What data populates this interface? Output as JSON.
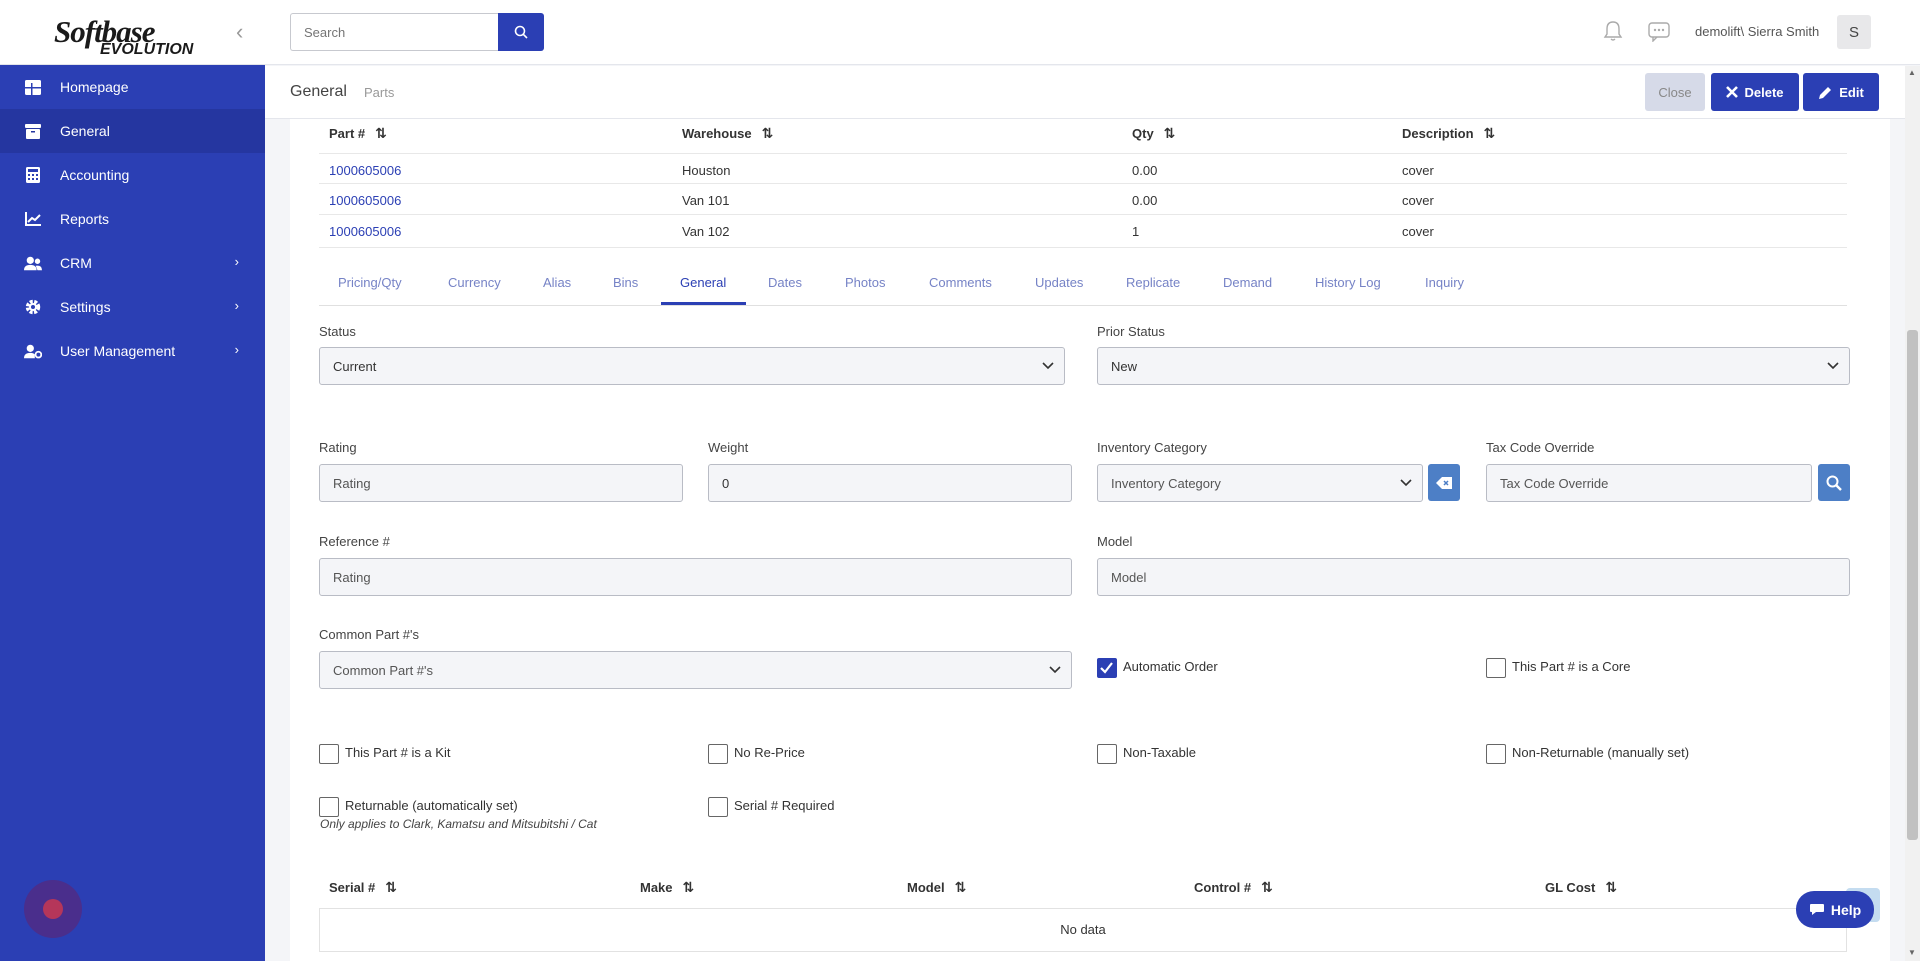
{
  "logo": {
    "line1": "Softbase",
    "line2": "EVOLUTION"
  },
  "sidebar": {
    "items": [
      {
        "label": "Homepage",
        "icon": "home-grid-icon",
        "active": false,
        "has_children": false
      },
      {
        "label": "General",
        "icon": "archive-box-icon",
        "active": true,
        "has_children": false
      },
      {
        "label": "Accounting",
        "icon": "calculator-icon",
        "active": false,
        "has_children": false
      },
      {
        "label": "Reports",
        "icon": "chart-line-icon",
        "active": false,
        "has_children": false
      },
      {
        "label": "CRM",
        "icon": "users-icon",
        "active": false,
        "has_children": true
      },
      {
        "label": "Settings",
        "icon": "gear-icon",
        "active": false,
        "has_children": true
      },
      {
        "label": "User Management",
        "icon": "user-cog-icon",
        "active": false,
        "has_children": true
      }
    ]
  },
  "topbar": {
    "search_placeholder": "Search",
    "user_name": "demolift\\ Sierra Smith",
    "avatar_letter": "S"
  },
  "subheader": {
    "title": "General",
    "subtitle": "Parts",
    "close_label": "Close",
    "delete_label": "Delete",
    "edit_label": "Edit"
  },
  "warehouse_table": {
    "headers": [
      "Part #",
      "Warehouse",
      "Qty",
      "Description"
    ],
    "rows": [
      [
        "1000605006",
        "Houston",
        "0.00",
        "cover"
      ],
      [
        "1000605006",
        "Van 101",
        "0.00",
        "cover"
      ],
      [
        "1000605006",
        "Van 102",
        "1",
        "cover"
      ]
    ]
  },
  "tabs": [
    "Pricing/Qty",
    "Currency",
    "Alias",
    "Bins",
    "General",
    "Dates",
    "Photos",
    "Comments",
    "Updates",
    "Replicate",
    "Demand",
    "History Log",
    "Inquiry"
  ],
  "active_tab": "General",
  "form": {
    "status_label": "Status",
    "status_value": "Current",
    "prior_status_label": "Prior Status",
    "prior_status_value": "New",
    "rating_label": "Rating",
    "rating_placeholder": "Rating",
    "weight_label": "Weight",
    "weight_value": "0",
    "inventory_category_label": "Inventory Category",
    "inventory_category_placeholder": "Inventory Category",
    "tax_code_label": "Tax Code Override",
    "tax_code_placeholder": "Tax Code Override",
    "reference_label": "Reference #",
    "reference_placeholder": "Rating",
    "model_label": "Model",
    "model_placeholder": "Model",
    "common_part_label": "Common Part #'s",
    "common_part_placeholder": "Common Part #'s"
  },
  "checkboxes": {
    "automatic_order": {
      "label": "Automatic Order",
      "checked": true
    },
    "is_core": {
      "label": "This Part # is a Core",
      "checked": false
    },
    "is_kit": {
      "label": "This Part # is a Kit",
      "checked": false
    },
    "no_reprice": {
      "label": "No Re-Price",
      "checked": false
    },
    "non_taxable": {
      "label": "Non-Taxable",
      "checked": false
    },
    "non_returnable": {
      "label": "Non-Returnable (manually set)",
      "checked": false
    },
    "returnable": {
      "label": "Returnable (automatically set)",
      "checked": false
    },
    "serial_required": {
      "label": "Serial # Required",
      "checked": false
    }
  },
  "returnable_note": "Only applies to Clark, Kamatsu and Mitsubitshi / Cat",
  "serial_table": {
    "headers": [
      "Serial #",
      "Make",
      "Model",
      "Control #",
      "GL Cost"
    ],
    "empty_text": "No data"
  },
  "help_label": "Help",
  "colors": {
    "primary": "#2b3fb4",
    "sidebar_active": "#2536a0",
    "link": "#2b3fb4",
    "tab_inactive": "#7683c6"
  }
}
